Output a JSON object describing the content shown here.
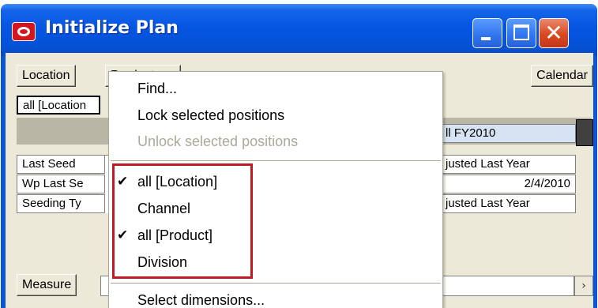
{
  "window": {
    "title": "Initialize Plan",
    "close_glyph": "✕",
    "accent_color": "#0a55d8"
  },
  "toolbar": {
    "location_label": "Location",
    "product_label": "Product",
    "calendar_label": "Calendar",
    "measure_label": "Measure"
  },
  "selector": {
    "value": "all [Location"
  },
  "grid": {
    "header": "ll FY2010",
    "rows": [
      {
        "label": "Last Seed",
        "value": "justed Last Year"
      },
      {
        "label": "Wp Last Se",
        "value": "2/4/2010"
      },
      {
        "label": "Seeding Ty",
        "value": "justed Last Year"
      }
    ]
  },
  "context_menu": {
    "items": [
      {
        "label": "Find...",
        "enabled": true
      },
      {
        "label": "Lock selected positions",
        "enabled": true
      },
      {
        "label": "Unlock selected positions",
        "enabled": false
      }
    ],
    "dimension_items": [
      {
        "label": "all [Location]",
        "checked": true,
        "check_glyph": "✔"
      },
      {
        "label": "Channel",
        "checked": false,
        "check_glyph": ""
      },
      {
        "label": "all [Product]",
        "checked": true,
        "check_glyph": "✔"
      },
      {
        "label": "Division",
        "checked": false,
        "check_glyph": ""
      }
    ],
    "footer_item": "Select dimensions...",
    "highlight_color": "#c01b24"
  },
  "scroll": {
    "right_arrow": "›"
  }
}
